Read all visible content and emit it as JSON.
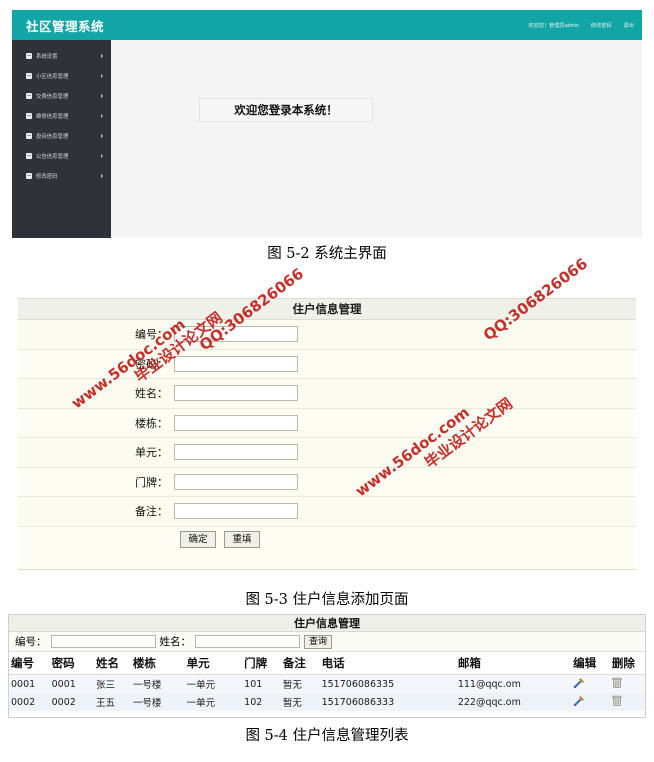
{
  "figure1": {
    "app": {
      "title": "社区管理系统",
      "header_right": {
        "greeting": "欢迎您！管理员admin",
        "change_password": "修改密码",
        "logout": "退出"
      },
      "sidebar": {
        "items": [
          {
            "label": "系统设置",
            "icon": "folder-icon",
            "arrow": "chevron-right-icon"
          },
          {
            "label": "小区信息管理",
            "icon": "folder-icon",
            "arrow": "chevron-right-icon"
          },
          {
            "label": "交费信息管理",
            "icon": "folder-icon",
            "arrow": "chevron-right-icon"
          },
          {
            "label": "维修信息管理",
            "icon": "folder-icon",
            "arrow": "chevron-right-icon"
          },
          {
            "label": "投诉信息管理",
            "icon": "folder-icon",
            "arrow": "chevron-right-icon"
          },
          {
            "label": "公告信息管理",
            "icon": "folder-icon",
            "arrow": "chevron-right-icon"
          },
          {
            "label": "修改密码",
            "icon": "folder-icon",
            "arrow": "chevron-right-icon"
          }
        ]
      },
      "welcome_message": "欢迎您登录本系统！"
    }
  },
  "figure2": {
    "title": "住户信息管理",
    "fields": [
      {
        "label": "编号：",
        "value": "",
        "placeholder": ""
      },
      {
        "label": "密码：",
        "value": "",
        "placeholder": ""
      },
      {
        "label": "姓名：",
        "value": "",
        "placeholder": ""
      },
      {
        "label": "楼栋：",
        "value": "",
        "placeholder": ""
      },
      {
        "label": "单元：",
        "value": "",
        "placeholder": ""
      },
      {
        "label": "门牌：",
        "value": "",
        "placeholder": ""
      },
      {
        "label": "备注：",
        "value": "",
        "placeholder": ""
      }
    ],
    "buttons": {
      "submit": "确定",
      "reset": "重填"
    }
  },
  "figure3": {
    "title": "住户信息管理",
    "search": {
      "id_label": "编号：",
      "id_value": "",
      "name_label": "姓名：",
      "name_value": "",
      "button": "查询"
    },
    "table": {
      "headers": [
        "编号",
        "密码",
        "姓名",
        "楼栋",
        "单元",
        "门牌",
        "备注",
        "电话",
        "邮箱",
        "编辑",
        "删除"
      ],
      "rows": [
        {
          "id": "0001",
          "password": "0001",
          "name": "张三",
          "building": "一号楼",
          "unit": "一单元",
          "door": "101",
          "note": "暂无",
          "phone": "151706086335",
          "email": "111@qqc.om",
          "edit_icon": "wrench-hammer-icon",
          "delete_icon": "trash-icon"
        },
        {
          "id": "0002",
          "password": "0002",
          "name": "王五",
          "building": "一号楼",
          "unit": "一单元",
          "door": "102",
          "note": "暂无",
          "phone": "151706086333",
          "email": "222@qqc.om",
          "edit_icon": "wrench-hammer-icon",
          "delete_icon": "trash-icon"
        }
      ]
    }
  },
  "captions": {
    "fig_5_2": "图 5-2 系统主界面",
    "fig_5_3": "图 5-3 住户信息添加页面",
    "fig_5_4": "图 5-4 住户信息管理列表"
  },
  "watermarks": {
    "site": "www.56doc.com",
    "qq": "QQ:306826066",
    "brand": "毕业设计论文网"
  },
  "colors": {
    "header_teal": "#12a5a5",
    "sidebar_dark": "#2f3238",
    "watermark_red": "#c0201c",
    "row_blue": "#f3f6fb"
  }
}
